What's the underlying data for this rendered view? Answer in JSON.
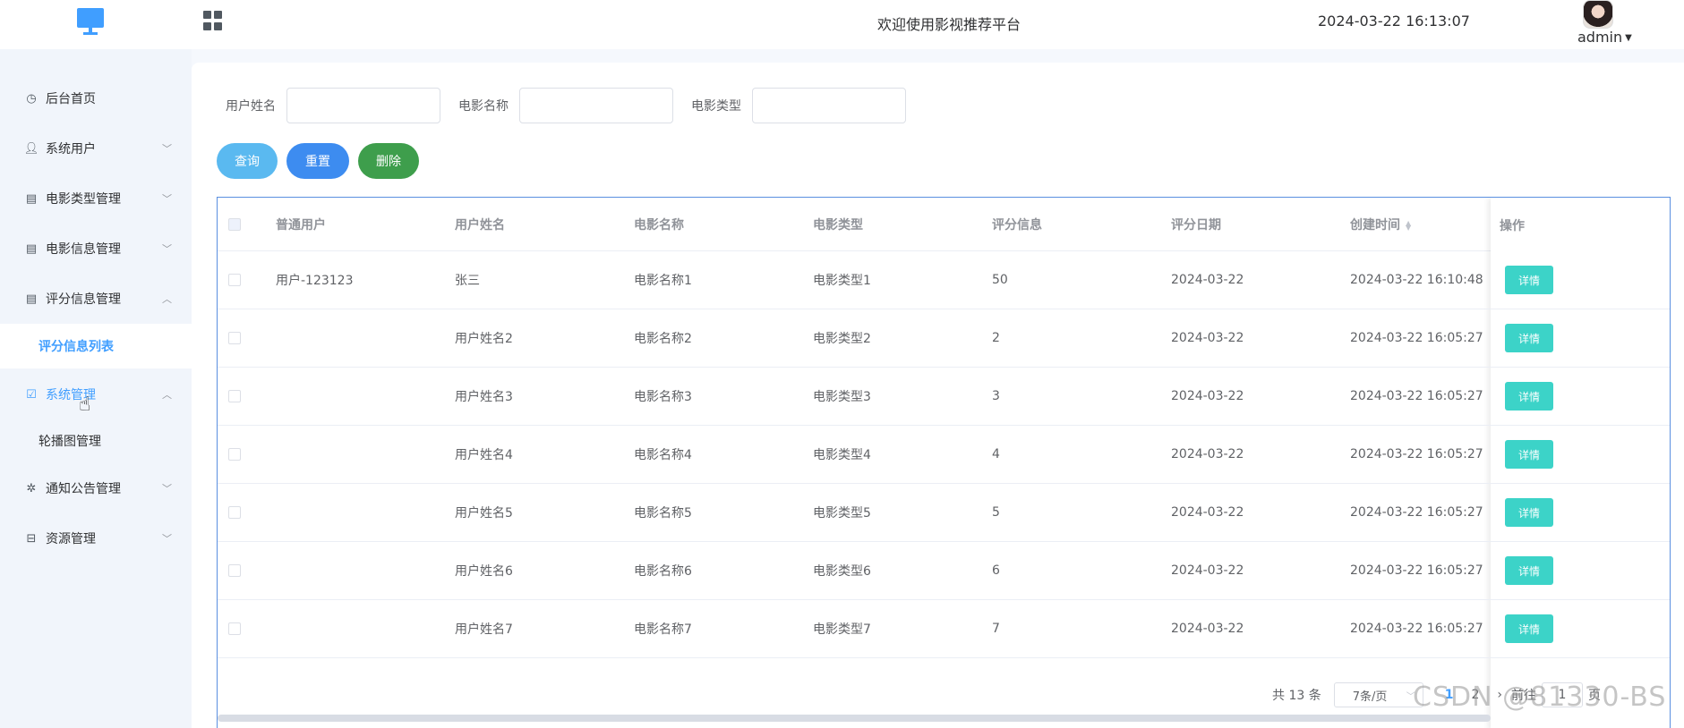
{
  "header": {
    "welcome": "欢迎使用影视推荐平台",
    "datetime": "2024-03-22 16:13:07",
    "user": "admin"
  },
  "sidebar": {
    "items": [
      {
        "label": "后台首页",
        "icon": "clock-icon"
      },
      {
        "label": "系统用户",
        "icon": "user-icon"
      },
      {
        "label": "电影类型管理",
        "icon": "card-icon"
      },
      {
        "label": "电影信息管理",
        "icon": "card-icon"
      },
      {
        "label": "评分信息管理",
        "icon": "card-icon"
      },
      {
        "label": "评分信息列表"
      },
      {
        "label": "系统管理",
        "icon": "checkbox-icon"
      },
      {
        "label": "轮播图管理"
      },
      {
        "label": "通知公告管理",
        "icon": "loading-icon"
      },
      {
        "label": "资源管理",
        "icon": "box-icon"
      }
    ]
  },
  "search": {
    "username_label": "用户姓名",
    "movie_label": "电影名称",
    "type_label": "电影类型"
  },
  "buttons": {
    "query": "查询",
    "reset": "重置",
    "delete": "删除"
  },
  "table": {
    "headers": [
      "普通用户",
      "用户姓名",
      "电影名称",
      "电影类型",
      "评分信息",
      "评分日期",
      "创建时间",
      "操作"
    ],
    "detail_label": "详情",
    "rows": [
      {
        "user": "用户-123123",
        "name": "张三",
        "movie": "电影名称1",
        "type": "电影类型1",
        "score": "50",
        "date": "2024-03-22",
        "created": "2024-03-22 16:10:48"
      },
      {
        "user": "",
        "name": "用户姓名2",
        "movie": "电影名称2",
        "type": "电影类型2",
        "score": "2",
        "date": "2024-03-22",
        "created": "2024-03-22 16:05:27"
      },
      {
        "user": "",
        "name": "用户姓名3",
        "movie": "电影名称3",
        "type": "电影类型3",
        "score": "3",
        "date": "2024-03-22",
        "created": "2024-03-22 16:05:27"
      },
      {
        "user": "",
        "name": "用户姓名4",
        "movie": "电影名称4",
        "type": "电影类型4",
        "score": "4",
        "date": "2024-03-22",
        "created": "2024-03-22 16:05:27"
      },
      {
        "user": "",
        "name": "用户姓名5",
        "movie": "电影名称5",
        "type": "电影类型5",
        "score": "5",
        "date": "2024-03-22",
        "created": "2024-03-22 16:05:27"
      },
      {
        "user": "",
        "name": "用户姓名6",
        "movie": "电影名称6",
        "type": "电影类型6",
        "score": "6",
        "date": "2024-03-22",
        "created": "2024-03-22 16:05:27"
      },
      {
        "user": "",
        "name": "用户姓名7",
        "movie": "电影名称7",
        "type": "电影类型7",
        "score": "7",
        "date": "2024-03-22",
        "created": "2024-03-22 16:05:27"
      }
    ]
  },
  "pager": {
    "total": "共 13 条",
    "size": "7条/页",
    "page1": "1",
    "page2": "2",
    "goto": "前往",
    "jump": "1",
    "page_suffix": "页"
  },
  "watermark": "CSDN @81330-BS",
  "colors": {
    "primary": "#409eff",
    "detail": "#3cd3c8",
    "delete": "#3e9e4c"
  }
}
